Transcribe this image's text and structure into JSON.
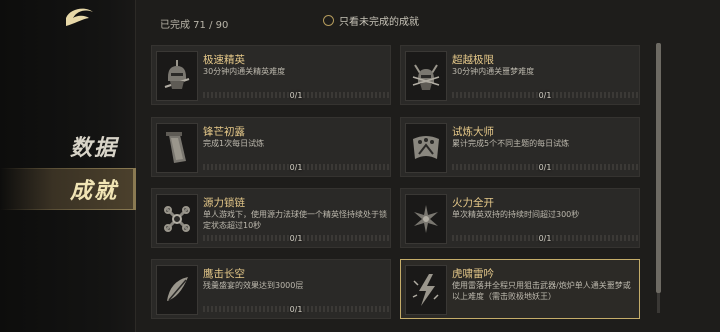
{
  "sidebar": {
    "logo_icon": "crescent-logo-icon",
    "items": [
      {
        "label": "数据",
        "active": false
      },
      {
        "label": "成就",
        "active": true
      }
    ]
  },
  "header": {
    "progress": "已完成 71 / 90",
    "filter_label": "只看未完成的成就"
  },
  "achievements": [
    {
      "title": "极速精英",
      "desc": "30分钟内通关精英难度",
      "progress": "0/1",
      "progress_value": 0,
      "icon": "helmet-sword-icon"
    },
    {
      "title": "超越极限",
      "desc": "30分钟内通关噩梦难度",
      "progress": "0/1",
      "progress_value": 0,
      "icon": "horned-helmet-icon"
    },
    {
      "title": "锋芒初露",
      "desc": "完成1次每日试炼",
      "progress": "0/1",
      "progress_value": 0,
      "icon": "blade-icon"
    },
    {
      "title": "试炼大师",
      "desc": "累计完成5个不同主题的每日试炼",
      "progress": "0/1",
      "progress_value": 0,
      "icon": "banner-icon"
    },
    {
      "title": "源力锁链",
      "desc": "单人游戏下，使用源力法球使一个精英怪持续处于锁定状态超过10秒",
      "progress": "0/1",
      "progress_value": 0,
      "icon": "chain-icon"
    },
    {
      "title": "火力全开",
      "desc": "单次精英双持的持续时间超过300秒",
      "progress": "0/1",
      "progress_value": 0,
      "icon": "burst-icon"
    },
    {
      "title": "鹰击长空",
      "desc": "残羹盛宴的效果达到3000层",
      "progress": "0/1",
      "progress_value": 0,
      "icon": "feather-icon"
    },
    {
      "title": "虎啸雷吟",
      "desc": "使用雷落并全程只用狙击武器/炮炉单人通关噩梦或以上难度（需击败极地妖王）",
      "progress": "",
      "progress_value": 0,
      "icon": "lightning-icon",
      "highlight": true
    }
  ]
}
